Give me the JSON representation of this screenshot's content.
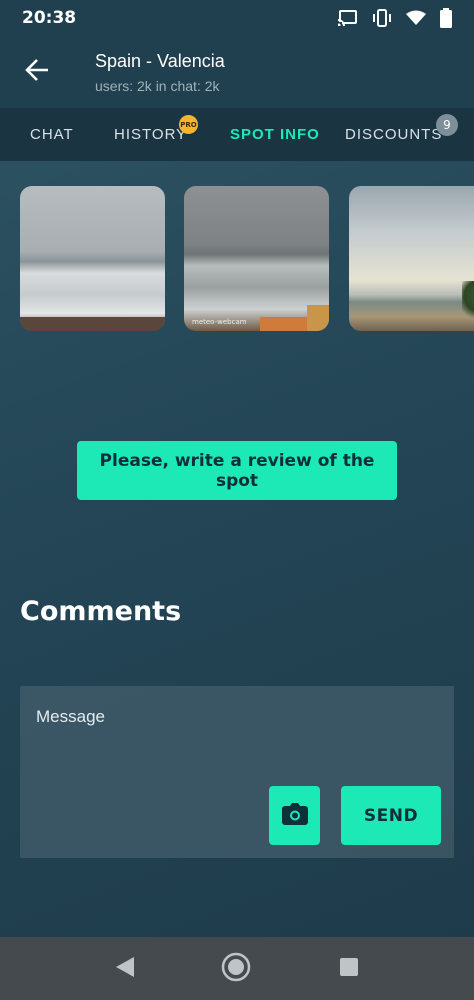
{
  "status_bar": {
    "time": "20:38",
    "icons": [
      "cast-icon",
      "vibrate-icon",
      "wifi-icon",
      "battery-icon"
    ]
  },
  "header": {
    "title": "Spain - Valencia",
    "subtitle": "users: 2k in chat: 2k",
    "back_icon": "arrow-left-icon"
  },
  "tabs": [
    {
      "label": "CHAT",
      "active": false
    },
    {
      "label": "HISTORY",
      "active": false,
      "badge": "PRO"
    },
    {
      "label": "SPOT INFO",
      "active": true
    },
    {
      "label": "DISCOUNTS",
      "active": false,
      "badge": "9"
    }
  ],
  "photos": {
    "watermark": "meteo-webcam"
  },
  "review_button": "Please, write a review of the spot",
  "comments": {
    "title": "Comments",
    "message_placeholder": "Message",
    "send_label": "SEND",
    "camera_icon": "camera-icon"
  },
  "nav_bar": {
    "icons": [
      "back-triangle-icon",
      "home-circle-icon",
      "recents-square-icon"
    ]
  },
  "colors": {
    "accent": "#1de9b6",
    "header_bg": "#21404f",
    "tabs_bg": "#1b3442",
    "pro_badge": "#f5b52e",
    "nav_bar": "#444a4e"
  }
}
